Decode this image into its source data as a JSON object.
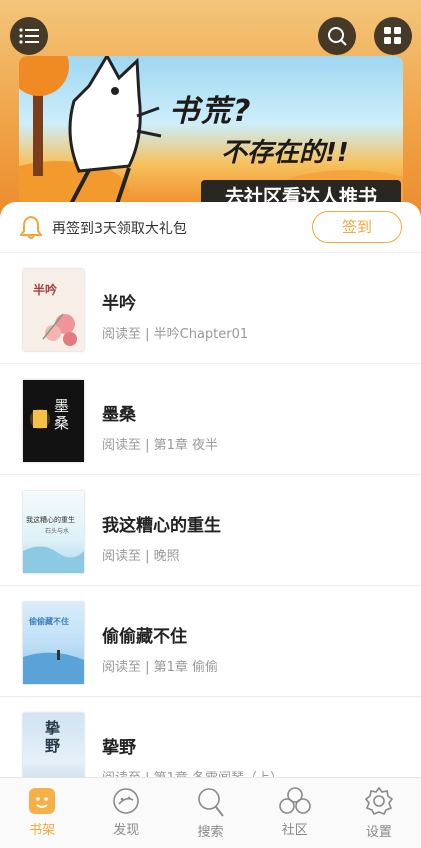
{
  "banner": {
    "headline_line1": "书荒?",
    "headline_line2": "不存在的!!",
    "cta": "去社区看达人推书"
  },
  "header": {
    "menu_icon": "menu-icon",
    "search_icon": "search-icon",
    "grid_icon": "grid-icon"
  },
  "checkin": {
    "text": "再签到3天领取大礼包",
    "button": "签到",
    "icon": "bell-icon",
    "accent": "#f0a93a"
  },
  "books": [
    {
      "title": "半吟",
      "progress": "阅读至 | 半吟Chapter01",
      "cover_text": "半吟"
    },
    {
      "title": "墨桑",
      "progress": "阅读至 | 第1章 夜半",
      "cover_text": "墨桑"
    },
    {
      "title": "我这糟心的重生",
      "progress": "阅读至 | 晚照",
      "cover_text": "我这糟心的重生",
      "cover_sub": "石头与水"
    },
    {
      "title": "偷偷藏不住",
      "progress": "阅读至 | 第1章 偷偷",
      "cover_text": "偷偷藏不住"
    },
    {
      "title": "挚野",
      "progress": "阅读至 | 第1章 冬雪闻琴（上）",
      "cover_text": "挚野"
    }
  ],
  "nav": [
    {
      "label": "书架",
      "icon": "bookshelf-icon",
      "active": true
    },
    {
      "label": "发现",
      "icon": "discover-icon",
      "active": false
    },
    {
      "label": "搜索",
      "icon": "search-icon",
      "active": false
    },
    {
      "label": "社区",
      "icon": "community-icon",
      "active": false
    },
    {
      "label": "设置",
      "icon": "settings-icon",
      "active": false
    }
  ]
}
